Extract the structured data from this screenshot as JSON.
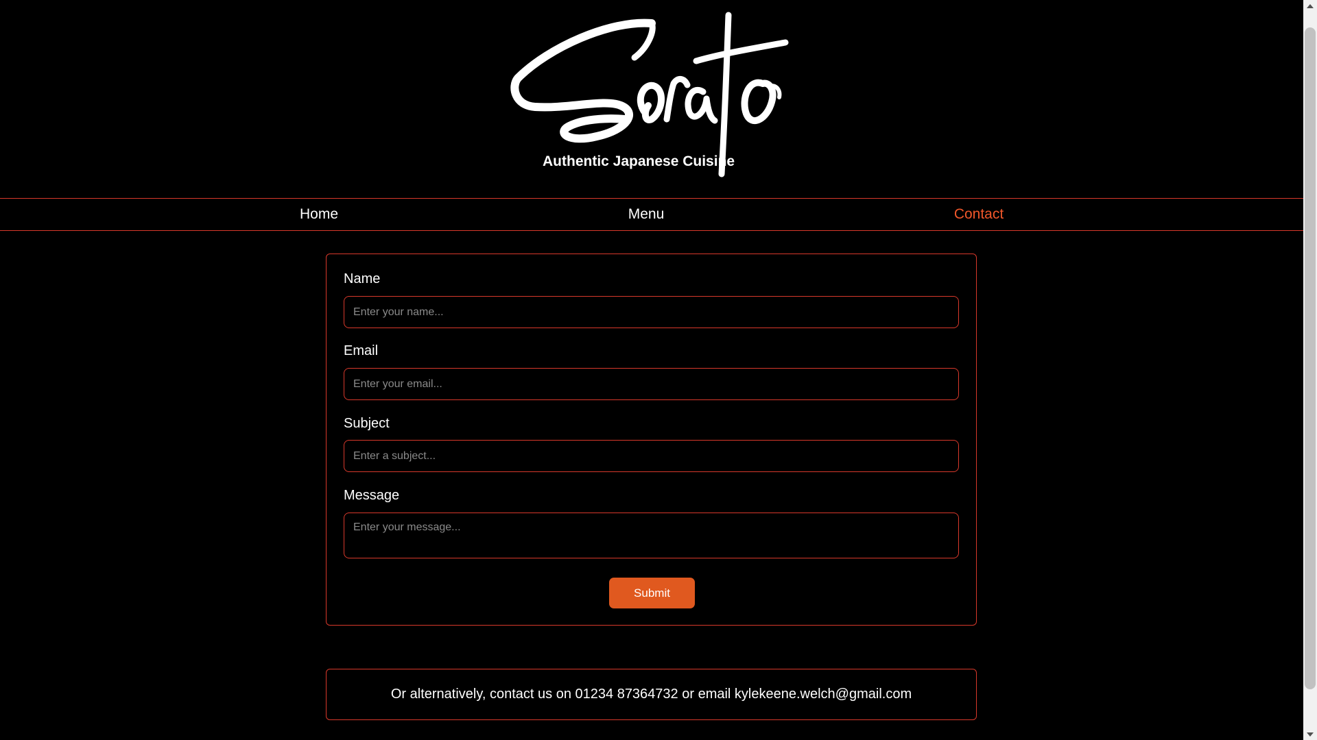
{
  "brand": {
    "logo_text": "Sorato",
    "tagline": "Authentic Japanese Cuisine"
  },
  "nav": {
    "items": [
      {
        "label": "Home"
      },
      {
        "label": "Menu"
      },
      {
        "label": "Contact"
      }
    ],
    "active": "Contact"
  },
  "form": {
    "fields": [
      {
        "label": "Name",
        "placeholder": "Enter your name...",
        "value": ""
      },
      {
        "label": "Email",
        "placeholder": "Enter your email...",
        "value": ""
      },
      {
        "label": "Subject",
        "placeholder": "Enter a subject...",
        "value": ""
      },
      {
        "label": "Message",
        "placeholder": "Enter your message...",
        "value": ""
      }
    ],
    "submit_label": "Submit"
  },
  "alt_contact": {
    "text": "Or alternatively, contact us on 01234 87364732 or email kylekeene.welch@gmail.com"
  },
  "colors": {
    "background": "#000000",
    "accent_border": "#d9392b",
    "active_nav": "#f0572a",
    "button": "#e0591f"
  },
  "icons": {
    "scroll_up": "chevron-up-icon",
    "scroll_down": "chevron-down-icon"
  }
}
